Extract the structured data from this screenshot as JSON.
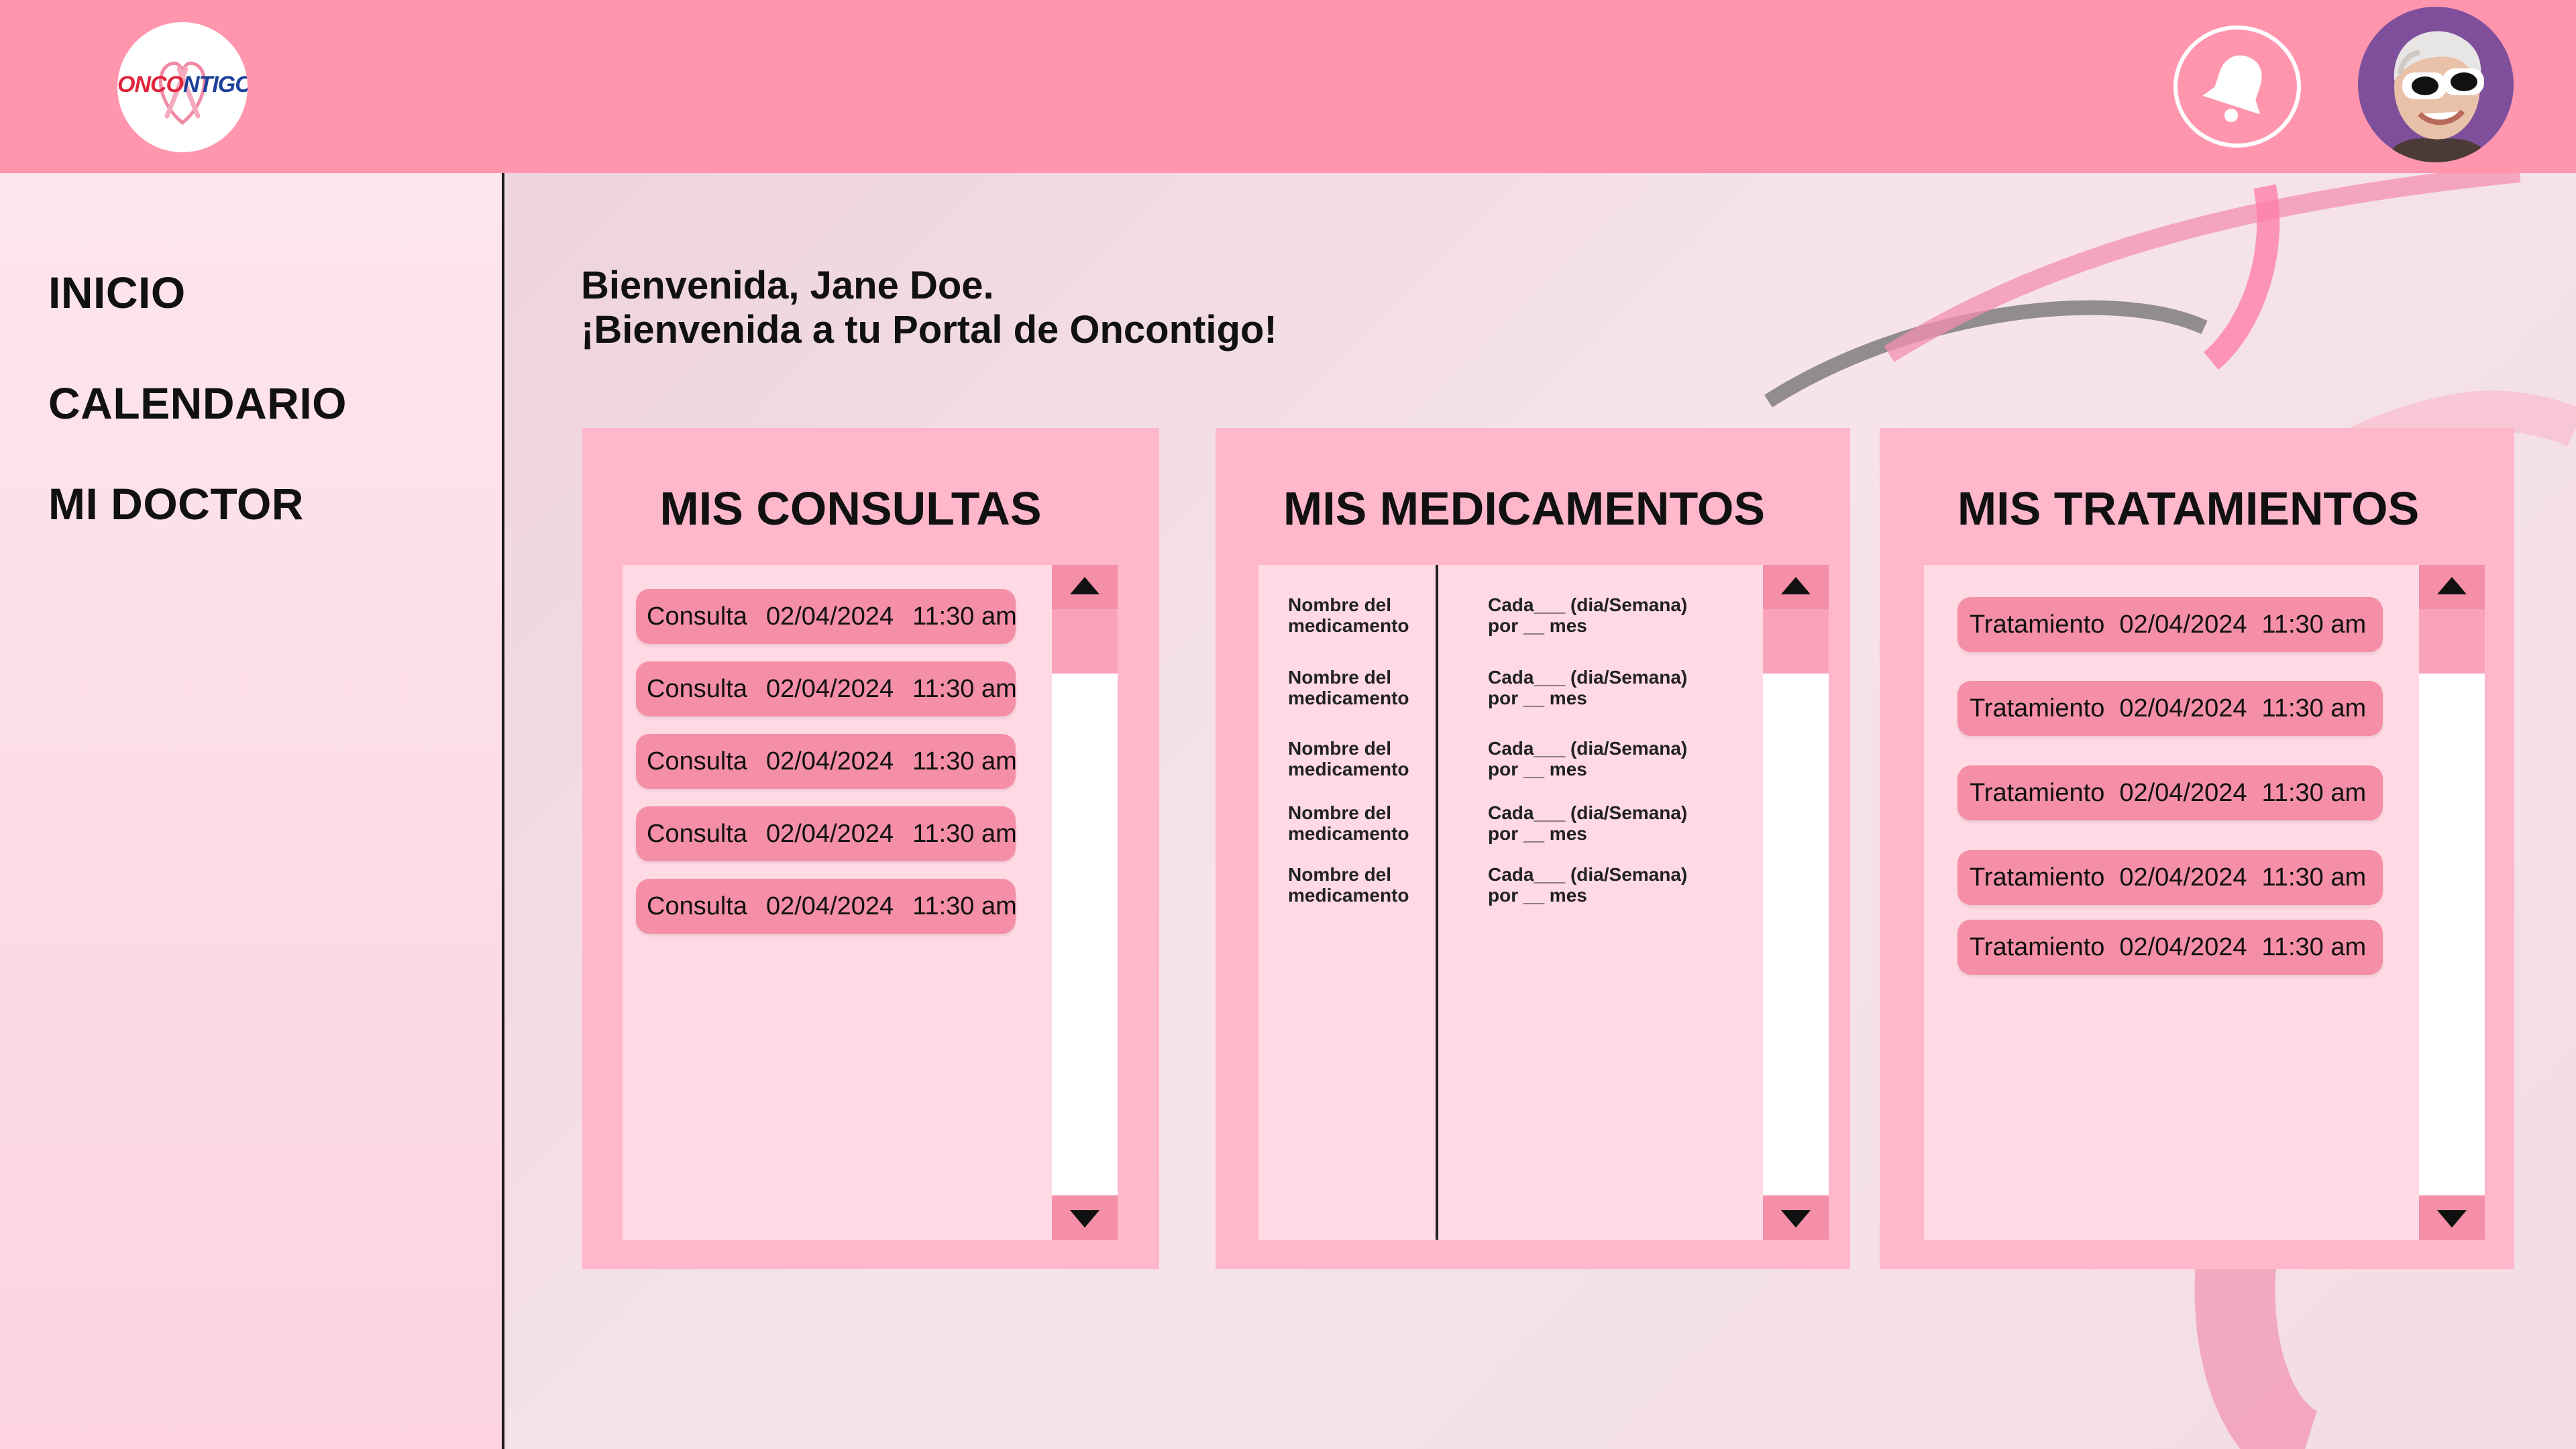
{
  "header": {
    "logo_text_a": "ONCO",
    "logo_text_b": "NTIGO",
    "icons": {
      "logo": "oncontigo-logo",
      "bell": "bell-icon",
      "avatar": "user-avatar"
    }
  },
  "sidebar": {
    "items": [
      {
        "label": "INICIO"
      },
      {
        "label": "CALENDARIO"
      },
      {
        "label": "MI DOCTOR"
      }
    ]
  },
  "welcome": {
    "line1": "Bienvenida, Jane Doe.",
    "line2": "¡Bienvenida a tu Portal de Oncontigo!"
  },
  "consultas": {
    "title": "MIS CONSULTAS",
    "items": [
      {
        "type": "Consulta",
        "date": "02/04/2024",
        "time": "11:30 am"
      },
      {
        "type": "Consulta",
        "date": "02/04/2024",
        "time": "11:30 am"
      },
      {
        "type": "Consulta",
        "date": "02/04/2024",
        "time": "11:30 am"
      },
      {
        "type": "Consulta",
        "date": "02/04/2024",
        "time": "11:30 am"
      },
      {
        "type": "Consulta",
        "date": "02/04/2024",
        "time": "11:30 am"
      }
    ]
  },
  "medicamentos": {
    "title": "MIS  MEDICAMENTOS",
    "items": [
      {
        "name_1": "Nombre del",
        "name_2": "medicamento",
        "freq_1": "Cada___ (dia/Semana)",
        "freq_2": "por __ mes"
      },
      {
        "name_1": "Nombre del",
        "name_2": "medicamento",
        "freq_1": "Cada___ (dia/Semana)",
        "freq_2": "por __ mes"
      },
      {
        "name_1": "Nombre del",
        "name_2": "medicamento",
        "freq_1": "Cada___ (dia/Semana)",
        "freq_2": "por __ mes"
      },
      {
        "name_1": "Nombre del",
        "name_2": "medicamento",
        "freq_1": "Cada___ (dia/Semana)",
        "freq_2": "por __ mes"
      },
      {
        "name_1": "Nombre del",
        "name_2": "medicamento",
        "freq_1": "Cada___ (dia/Semana)",
        "freq_2": "por __ mes"
      }
    ]
  },
  "tratamientos": {
    "title": "MIS TRATAMIENTOS",
    "items": [
      {
        "type": "Tratamiento",
        "date": "02/04/2024",
        "time": "11:30 am"
      },
      {
        "type": "Tratamiento",
        "date": "02/04/2024",
        "time": "11:30 am"
      },
      {
        "type": "Tratamiento",
        "date": "02/04/2024",
        "time": "11:30 am"
      },
      {
        "type": "Tratamiento",
        "date": "02/04/2024",
        "time": "11:30 am"
      },
      {
        "type": "Tratamiento",
        "date": "02/04/2024",
        "time": "11:30 am"
      }
    ]
  },
  "colors": {
    "header": "#ff96ae",
    "card": "#ffb7cb",
    "panel": "#ffd9e3",
    "pill": "#f48fa7"
  }
}
